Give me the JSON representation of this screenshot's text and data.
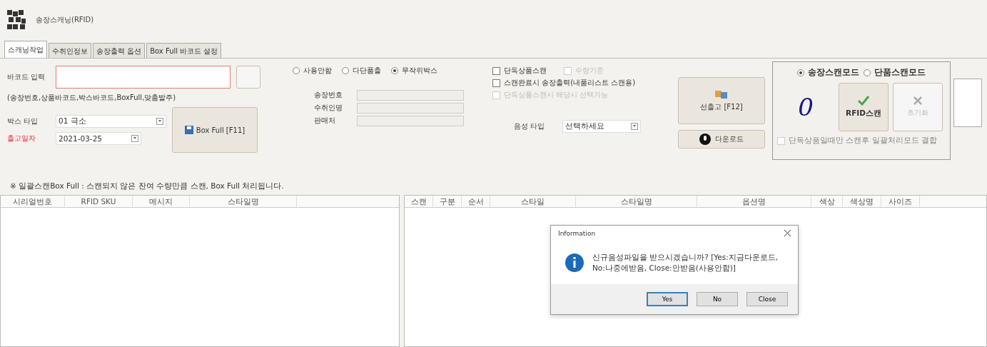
{
  "window": {
    "title": "송장스캐닝(RFID)"
  },
  "tabs": [
    {
      "label": "스캐닝작업",
      "selected": true
    },
    {
      "label": "수취인정보",
      "selected": false
    },
    {
      "label": "송장출력 옵션",
      "selected": false
    },
    {
      "label": "Box Full 바코드 설정",
      "selected": false
    }
  ],
  "barcode": {
    "label": "바코드 입력",
    "hint": "(송장번호,상품바코드,박스바코드,BoxFull,맞춤발주)"
  },
  "box_type": {
    "label": "박스 타입",
    "value": "01 극소"
  },
  "ship_date": {
    "label": "출고일자",
    "value": "2021-03-25"
  },
  "box_full_button": "Box Full [F11]",
  "radios": [
    {
      "label": "사용안함",
      "selected": false
    },
    {
      "label": "다단품출",
      "selected": false
    },
    {
      "label": "무작위박스",
      "selected": true
    }
  ],
  "info_fields": [
    {
      "label": "송장번호"
    },
    {
      "label": "수취인명"
    },
    {
      "label": "판매처"
    }
  ],
  "checkboxes": [
    {
      "label": "단독상품스캔",
      "checked": false,
      "disabled": false
    },
    {
      "label": "수량기준",
      "checked": false,
      "disabled": true
    },
    {
      "label": "스캔완료시 송장출력(내품리스트 스캔용)",
      "checked": false,
      "disabled": false
    },
    {
      "label": "단독상품스캔시 해당시 선택가능",
      "checked": false,
      "disabled": true
    }
  ],
  "voice_type": {
    "label": "음성 타입",
    "value": "선택하세요"
  },
  "pre_ship_button": "선출고 [F12]",
  "download_button": "다운로드",
  "mode_panel": {
    "modes": [
      {
        "label": "송장스캔모드",
        "selected": true
      },
      {
        "label": "단품스캔모드",
        "selected": false
      }
    ],
    "count": "0",
    "scan_button": "RFID스캔",
    "reset_button": "초기화",
    "option": {
      "label": "단독상품일때만 스캔후 일괄처리모드 결합",
      "checked": false,
      "disabled": true
    }
  },
  "notice": "※ 일괄스캔Box Full : 스캔되지 않은 잔여 수량만큼 스캔, Box Full 처리됩니다.",
  "left_table": {
    "columns": [
      "시리얼번호",
      "RFID SKU",
      "메시지",
      "스타일명"
    ]
  },
  "right_table": {
    "columns": [
      "스캔",
      "구분",
      "순서",
      "스타일",
      "스타일명",
      "옵션명",
      "색상",
      "색상명",
      "사이즈"
    ]
  },
  "dialog": {
    "title": "Information",
    "message": "신규음성파일을 받으시겠습니까? [Yes:지금다운로드,\nNo:나중에받음, Close:안받음(사용안함)]",
    "buttons": [
      "Yes",
      "No",
      "Close"
    ]
  }
}
